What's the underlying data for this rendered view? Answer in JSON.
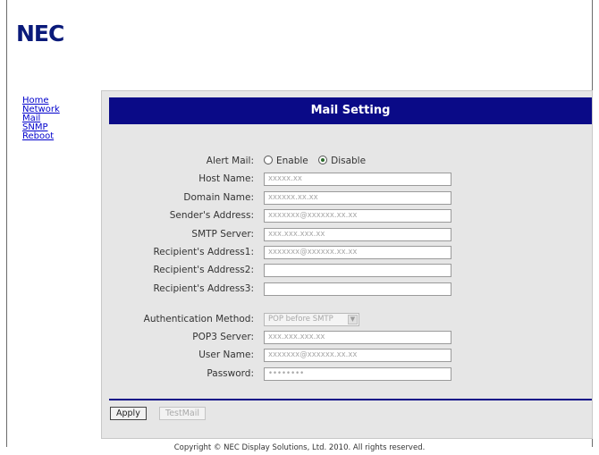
{
  "brand": {
    "logo_text": "NEC",
    "color": "#0a1a7a"
  },
  "nav": {
    "items": [
      {
        "label": "Home"
      },
      {
        "label": "Network"
      },
      {
        "label": "Mail"
      },
      {
        "label": "SNMP"
      },
      {
        "label": "Reboot"
      }
    ]
  },
  "panel": {
    "title": "Mail Setting",
    "title_bg": "#0a0a87"
  },
  "form": {
    "alert_mail": {
      "label": "Alert Mail:",
      "enable": "Enable",
      "disable": "Disable",
      "selected": "Disable"
    },
    "host_name": {
      "label": "Host Name:",
      "placeholder": "xxxxx.xx"
    },
    "domain_name": {
      "label": "Domain Name:",
      "placeholder": "xxxxxx.xx.xx"
    },
    "sender_address": {
      "label": "Sender's Address:",
      "placeholder": "xxxxxxx@xxxxxx.xx.xx"
    },
    "smtp_server": {
      "label": "SMTP Server:",
      "placeholder": "xxx.xxx.xxx.xx"
    },
    "recipient1": {
      "label": "Recipient's Address1:",
      "placeholder": "xxxxxxx@xxxxxx.xx.xx"
    },
    "recipient2": {
      "label": "Recipient's Address2:",
      "placeholder": ""
    },
    "recipient3": {
      "label": "Recipient's Address3:",
      "placeholder": ""
    },
    "auth_method": {
      "label": "Authentication Method:",
      "value": "POP before SMTP"
    },
    "pop3_server": {
      "label": "POP3 Server:",
      "placeholder": "xxx.xxx.xxx.xx"
    },
    "user_name": {
      "label": "User Name:",
      "placeholder": "xxxxxxx@xxxxxx.xx.xx"
    },
    "password": {
      "label": "Password:",
      "value": "••••••••"
    }
  },
  "buttons": {
    "apply": "Apply",
    "test_mail": "TestMail"
  },
  "footer": {
    "copyright": "Copyright © NEC Display Solutions, Ltd. 2010. All rights reserved."
  }
}
